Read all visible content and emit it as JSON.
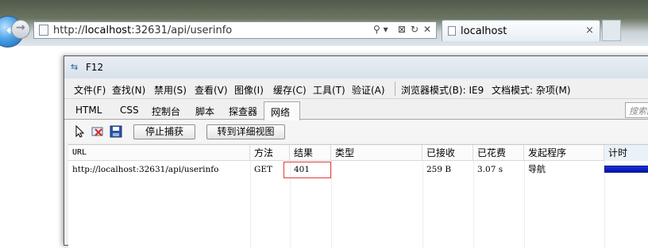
{
  "browser": {
    "url_scheme": "http://",
    "url_host": "localhost",
    "url_rest": ":32631/api/userinfo",
    "tab_title": "localhost",
    "tab_close": "×",
    "address_buttons": [
      "⚲ ▾",
      "⊠",
      "↻",
      "✕"
    ]
  },
  "devtools": {
    "title": "F12",
    "title_icon": "⇆",
    "menu": [
      "文件(F)",
      "查找(N)",
      "禁用(S)",
      "查看(V)",
      "图像(I)",
      "缓存(C)",
      "工具(T)",
      "验证(A)"
    ],
    "browser_mode": "浏览器模式(B): IE9",
    "document_mode": "文档模式: 杂项(M)",
    "tabs": [
      "HTML",
      "CSS",
      "控制台",
      "脚本",
      "探查器",
      "网络"
    ],
    "search_placeholder": "搜索网",
    "toolbar": {
      "stop_capture": "停止捕获",
      "detailed_view": "转到详细视图"
    },
    "network": {
      "columns": [
        "URL",
        "方法",
        "结果",
        "类型",
        "已接收",
        "已花费",
        "发起程序",
        "计时"
      ],
      "rows": [
        {
          "url": "http://localhost:32631/api/userinfo",
          "method": "GET",
          "result": "401",
          "type": "",
          "received": "259 B",
          "taken": "3.07 s",
          "initiator": "导航"
        }
      ]
    }
  }
}
